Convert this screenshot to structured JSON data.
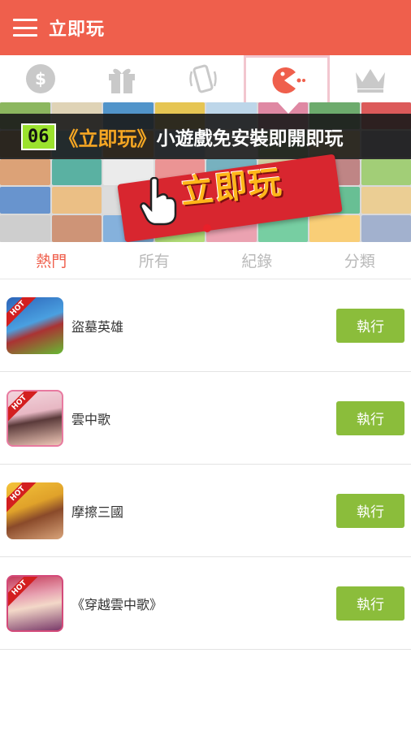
{
  "appbar": {
    "title": "立即玩"
  },
  "iconbar": {
    "icons": [
      "dollar-coin-icon",
      "gift-icon",
      "phone-shake-icon",
      "pacman-icon",
      "crown-icon"
    ],
    "active_index": 3
  },
  "banner": {
    "number": "06",
    "accent": "《立即玩》",
    "text": "小遊戲免安裝即開即玩",
    "ribbon_text": "立即玩"
  },
  "tabs": [
    {
      "label": "熱門",
      "active": true
    },
    {
      "label": "所有",
      "active": false
    },
    {
      "label": "紀錄",
      "active": false
    },
    {
      "label": "分類",
      "active": false
    }
  ],
  "games": [
    {
      "title": "盜墓英雄",
      "badge": "HOT",
      "button": "執行"
    },
    {
      "title": "雲中歌",
      "badge": "HOT",
      "button": "執行"
    },
    {
      "title": "摩擦三國",
      "badge": "HOT",
      "button": "執行"
    },
    {
      "title": "《穿越雲中歌》",
      "badge": "HOT",
      "button": "執行"
    }
  ],
  "colors": {
    "primary": "#ef5f4c",
    "button": "#8bbd3b",
    "accent_green": "#9be22e",
    "accent_orange": "#f5a623"
  }
}
